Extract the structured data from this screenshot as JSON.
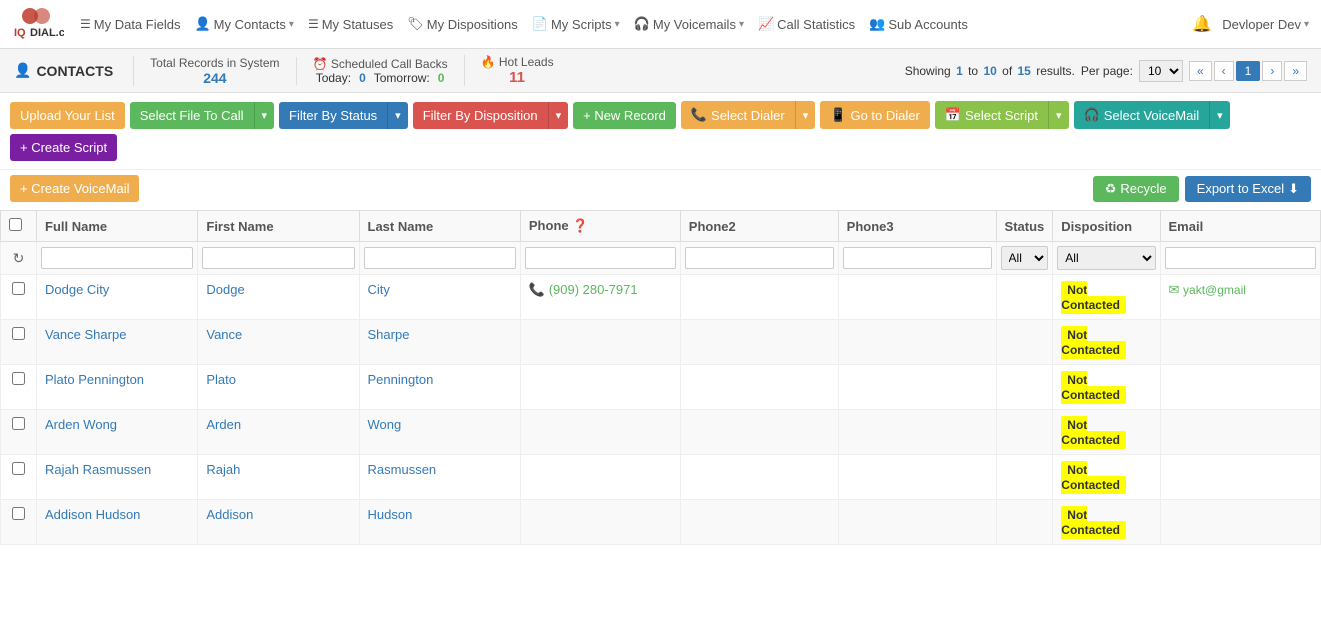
{
  "brand": {
    "name": "IQDIAL.com"
  },
  "nav": {
    "items": [
      {
        "id": "my-data-fields",
        "label": "My Data Fields",
        "icon": "list-icon",
        "hasDropdown": false
      },
      {
        "id": "my-contacts",
        "label": "My Contacts",
        "icon": "user-icon",
        "hasDropdown": true
      },
      {
        "id": "my-statuses",
        "label": "My Statuses",
        "icon": "list-icon",
        "hasDropdown": false
      },
      {
        "id": "my-dispositions",
        "label": "My Dispositions",
        "icon": "tag-icon",
        "hasDropdown": false
      },
      {
        "id": "my-scripts",
        "label": "My Scripts",
        "icon": "file-icon",
        "hasDropdown": true
      },
      {
        "id": "my-voicemails",
        "label": "My Voicemails",
        "icon": "headset-icon",
        "hasDropdown": true
      },
      {
        "id": "call-statistics",
        "label": "Call Statistics",
        "icon": "chart-icon",
        "hasDropdown": false
      },
      {
        "id": "sub-accounts",
        "label": "Sub Accounts",
        "icon": "users-icon",
        "hasDropdown": false
      }
    ],
    "right": {
      "bell_icon": "bell",
      "user_label": "Devloper Dev",
      "user_dropdown": true
    }
  },
  "topbar": {
    "section_icon": "user-icon",
    "section_title": "CONTACTS",
    "total_records_label": "Total Records in System",
    "total_records_value": "244",
    "scheduled_label": "Scheduled Call Backs",
    "today_label": "Today:",
    "today_value": "0",
    "tomorrow_label": "Tomorrow:",
    "tomorrow_value": "0",
    "hot_leads_label": "Hot Leads",
    "hot_leads_value": "11",
    "showing_prefix": "Showing",
    "showing_from": "1",
    "showing_to": "10",
    "showing_of": "of",
    "showing_total": "15",
    "showing_suffix": "results.",
    "per_page_label": "Per page:",
    "per_page_value": "10",
    "pages": [
      "«",
      "‹",
      "1",
      "›",
      "»"
    ]
  },
  "toolbar": {
    "upload_label": "Upload Your List",
    "select_file_label": "Select File To Call",
    "filter_status_label": "Filter By Status",
    "filter_disposition_label": "Filter By Disposition",
    "new_record_label": "+ New Record",
    "select_dialer_label": "Select Dialer",
    "go_to_dialer_label": "Go to Dialer",
    "select_script_label": "Select Script",
    "select_voicemail_label": "Select VoiceMail",
    "create_script_label": "+ Create Script",
    "create_voicemail_label": "+ Create VoiceMail",
    "recycle_label": "Recycle",
    "export_label": "Export to Excel"
  },
  "table": {
    "columns": [
      "Full Name",
      "First Name",
      "Last Name",
      "Phone",
      "Phone2",
      "Phone3",
      "Status",
      "Disposition",
      "Email"
    ],
    "filter_placeholders": [
      "",
      "",
      "",
      "",
      "",
      "",
      "All",
      "All",
      ""
    ],
    "rows": [
      {
        "full_name": "Dodge City",
        "first_name": "Dodge",
        "last_name": "City",
        "phone": "(909) 280-7971",
        "phone2": "",
        "phone3": "",
        "status": "",
        "disposition": "Not Contacted",
        "email": "yakt@gmail"
      },
      {
        "full_name": "Vance Sharpe",
        "first_name": "Vance",
        "last_name": "Sharpe",
        "phone": "",
        "phone2": "",
        "phone3": "",
        "status": "",
        "disposition": "Not Contacted",
        "email": ""
      },
      {
        "full_name": "Plato Pennington",
        "first_name": "Plato",
        "last_name": "Pennington",
        "phone": "",
        "phone2": "",
        "phone3": "",
        "status": "",
        "disposition": "Not Contacted",
        "email": ""
      },
      {
        "full_name": "Arden Wong",
        "first_name": "Arden",
        "last_name": "Wong",
        "phone": "",
        "phone2": "",
        "phone3": "",
        "status": "",
        "disposition": "Not Contacted",
        "email": ""
      },
      {
        "full_name": "Rajah Rasmussen",
        "first_name": "Rajah",
        "last_name": "Rasmussen",
        "phone": "",
        "phone2": "",
        "phone3": "",
        "status": "",
        "disposition": "Not Contacted",
        "email": ""
      },
      {
        "full_name": "Addison Hudson",
        "first_name": "Addison",
        "last_name": "Hudson",
        "phone": "",
        "phone2": "",
        "phone3": "",
        "status": "",
        "disposition": "Not Contacted",
        "email": ""
      }
    ]
  },
  "colors": {
    "accent_blue": "#337ab7",
    "accent_green": "#5cb85c",
    "accent_yellow": "#f0ad4e",
    "accent_red": "#d9534f",
    "not_contacted_bg": "#ffff00"
  }
}
